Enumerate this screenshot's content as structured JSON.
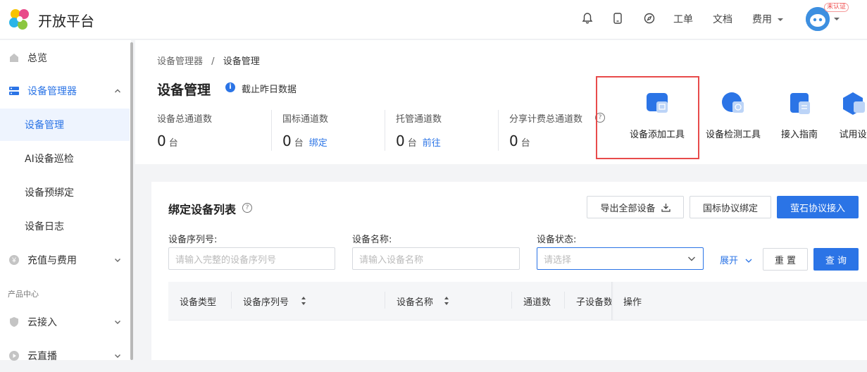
{
  "header": {
    "brand": "开放平台",
    "nav": [
      "工单",
      "文档",
      "费用"
    ],
    "badge": "未认证",
    "icons": [
      "bell-icon",
      "tablet-icon",
      "compass-icon"
    ]
  },
  "sidebar": {
    "items": [
      {
        "label": "总览",
        "icon": "home-icon"
      },
      {
        "label": "设备管理器",
        "icon": "server-icon"
      },
      {
        "label": "设备管理"
      },
      {
        "label": "AI设备巡检"
      },
      {
        "label": "设备预绑定"
      },
      {
        "label": "设备日志"
      },
      {
        "label": "充值与费用",
        "icon": "yen-icon"
      }
    ],
    "group_label": "产品中心",
    "group_items": [
      {
        "label": "云接入",
        "icon": "shield-icon"
      },
      {
        "label": "云直播",
        "icon": "play-icon"
      }
    ]
  },
  "breadcrumb": {
    "parent": "设备管理器",
    "separator": "/",
    "current": "设备管理"
  },
  "page": {
    "title": "设备管理",
    "info_text": "截止昨日数据"
  },
  "stats": [
    {
      "label": "设备总通道数",
      "value": "0",
      "unit": "台",
      "link": ""
    },
    {
      "label": "国标通道数",
      "value": "0",
      "unit": "台",
      "link": "绑定"
    },
    {
      "label": "托管通道数",
      "value": "0",
      "unit": "台",
      "link": "前往"
    },
    {
      "label": "分享计费总通道数",
      "value": "0",
      "unit": "台",
      "link": ""
    }
  ],
  "tools": [
    {
      "label": "设备添加工具",
      "icon": "device-add-tool-icon"
    },
    {
      "label": "设备检测工具",
      "icon": "device-check-tool-icon"
    },
    {
      "label": "接入指南",
      "icon": "guide-icon"
    },
    {
      "label": "试用设",
      "icon": "trial-device-icon"
    }
  ],
  "card": {
    "title": "绑定设备列表",
    "buttons": {
      "export": "导出全部设备",
      "gb_bind": "国标协议绑定",
      "ezviz": "萤石协议接入"
    },
    "filters": [
      {
        "label": "设备序列号:",
        "placeholder": "请输入完整的设备序列号"
      },
      {
        "label": "设备名称:",
        "placeholder": "请输入设备名称"
      },
      {
        "label": "设备状态:",
        "placeholder": "请选择"
      }
    ],
    "expand": "展开",
    "reset": "重 置",
    "query": "查 询",
    "columns": [
      "设备类型",
      "设备序列号",
      "设备名称",
      "通道数",
      "子设备数",
      "操作"
    ]
  },
  "colors": {
    "accent": "#2b74e6",
    "highlight_border": "#e84b4b"
  }
}
